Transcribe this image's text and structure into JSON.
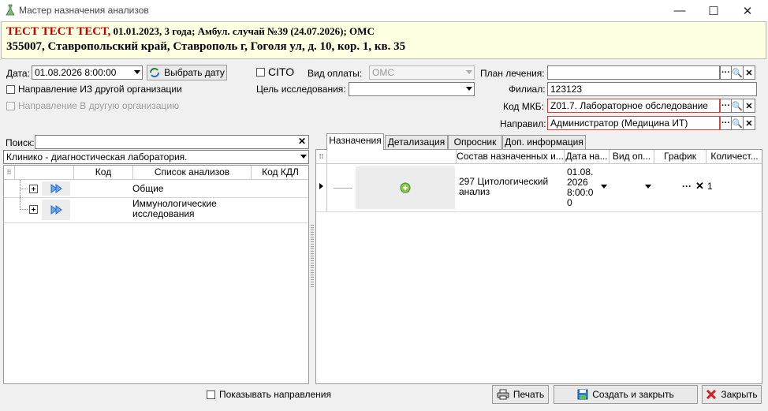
{
  "window": {
    "title": "Мастер назначения анализов",
    "minimize": "—",
    "maximize": "☐",
    "close": "✕"
  },
  "header": {
    "patient_name": "ТЕСТ ТЕСТ ТЕСТ,",
    "patient_info": " 01.01.2023, 3 года; Амбул. случай №39 (24.07.2026); ОМС",
    "address": "355007, Ставропольский край, Ставрополь г, Гоголя ул, д. 10, кор. 1, кв. 35"
  },
  "form": {
    "date_label": "Дата:",
    "date_value": "01.08.2026 8:00:00",
    "pick_date_button": "Выбрать дату",
    "cito_label": "CITO",
    "payment_label": "Вид оплаты:",
    "payment_value": "ОМС",
    "plan_label": "План лечения:",
    "plan_value": "",
    "from_other_org_label": "Направление ИЗ другой организации",
    "purpose_label": "Цель исследования:",
    "purpose_value": "",
    "branch_label": "Филиал:",
    "branch_value": "123123",
    "to_other_org_label": "Направление В другую организацию",
    "mkb_label": "Код МКБ:",
    "mkb_value": "Z01.7. Лабораторное обследование",
    "sender_label": "Направил:",
    "sender_value": "Администратор (Медицина ИТ)",
    "btn_dots": "···",
    "btn_search": "🔍",
    "btn_clear": "✕"
  },
  "left": {
    "search_label": "Поиск:",
    "search_value": "",
    "search_clear": "✕",
    "lab_value": "Клинико - диагностическая лаборатория.",
    "columns": [
      "Код",
      "Список анализов",
      "Код КДЛ"
    ],
    "rows": [
      {
        "name": "Общие"
      },
      {
        "name": "Иммунологические исследования"
      }
    ]
  },
  "tabs": [
    "Назначения",
    "Детализация",
    "Опросник",
    "Доп. информация"
  ],
  "right": {
    "columns": [
      "Состав назначенных и...",
      "Дата на...",
      "Вид оп...",
      "График",
      "Количест..."
    ],
    "rows": [
      {
        "composition": "297 Цитологический анализ",
        "date": "01.08.2026 8:00:00",
        "count": "1",
        "graph_dots": "···",
        "graph_x": "✕"
      }
    ]
  },
  "footer": {
    "show_direction_label": "Показывать направления",
    "print_button": "Печать",
    "create_close_button": "Создать и закрыть",
    "close_button": "Закрыть"
  },
  "colors": {
    "accent_red": "#c00000",
    "header_bg": "#ffffe1",
    "icon_blue": "#1a6fd0",
    "icon_green": "#3a9a2a"
  }
}
